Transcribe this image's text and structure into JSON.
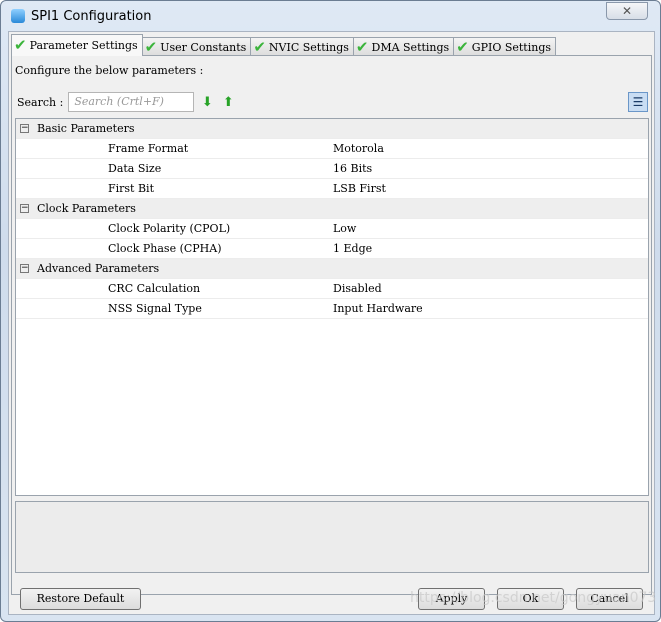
{
  "window": {
    "title": "SPI1 Configuration",
    "close_label": "✕"
  },
  "tabs": [
    {
      "label": "Parameter Settings",
      "active": true
    },
    {
      "label": "User Constants"
    },
    {
      "label": "NVIC Settings"
    },
    {
      "label": "DMA Settings"
    },
    {
      "label": "GPIO Settings"
    }
  ],
  "panel": {
    "instruction": "Configure the below parameters :",
    "search_label": "Search :",
    "search_placeholder": "Search (Crtl+F)"
  },
  "groups": [
    {
      "label": "Basic Parameters",
      "params": [
        {
          "name": "Frame Format",
          "value": "Motorola"
        },
        {
          "name": "Data Size",
          "value": "16 Bits"
        },
        {
          "name": "First Bit",
          "value": "LSB First"
        }
      ]
    },
    {
      "label": "Clock Parameters",
      "params": [
        {
          "name": "Clock Polarity (CPOL)",
          "value": "Low"
        },
        {
          "name": "Clock Phase (CPHA)",
          "value": "1 Edge"
        }
      ]
    },
    {
      "label": "Advanced Parameters",
      "params": [
        {
          "name": "CRC Calculation",
          "value": "Disabled"
        },
        {
          "name": "NSS Signal Type",
          "value": "Input Hardware"
        }
      ]
    }
  ],
  "buttons": {
    "restore": "Restore Default",
    "apply": "Apply",
    "ok": "Ok",
    "cancel": "Cancel"
  },
  "watermark": "https://blog.csdn.net/gongyuan073"
}
